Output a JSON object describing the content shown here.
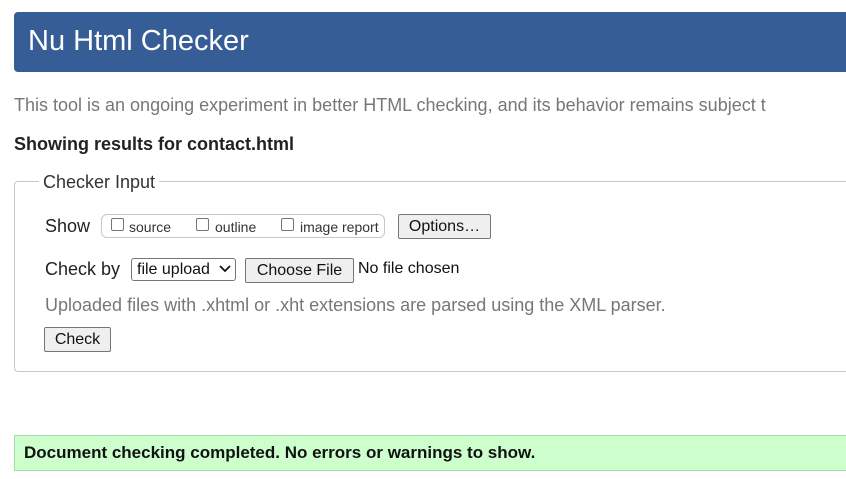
{
  "header": {
    "title": "Nu Html Checker"
  },
  "intro": {
    "text": "This tool is an ongoing experiment in better HTML checking, and its behavior remains subject t"
  },
  "results": {
    "title": "Showing results for contact.html"
  },
  "checker_input": {
    "legend": "Checker Input",
    "show_label": "Show",
    "options": [
      {
        "label": "source",
        "checked": false
      },
      {
        "label": "outline",
        "checked": false
      },
      {
        "label": "image report",
        "checked": false
      }
    ],
    "options_button": "Options…",
    "check_by_label": "Check by",
    "check_by_selected": "file upload",
    "choose_file_button": "Choose File",
    "no_file_text": "No file chosen",
    "hint": "Uploaded files with .xhtml or .xht extensions are parsed using the XML parser.",
    "check_button": "Check"
  },
  "status": {
    "message": "Document checking completed. No errors or warnings to show.",
    "color": "#ccffcc"
  },
  "colors": {
    "header": "#365d95",
    "muted_text": "#777777"
  },
  "icons": {
    "select_arrow": "chevron-down-icon"
  }
}
